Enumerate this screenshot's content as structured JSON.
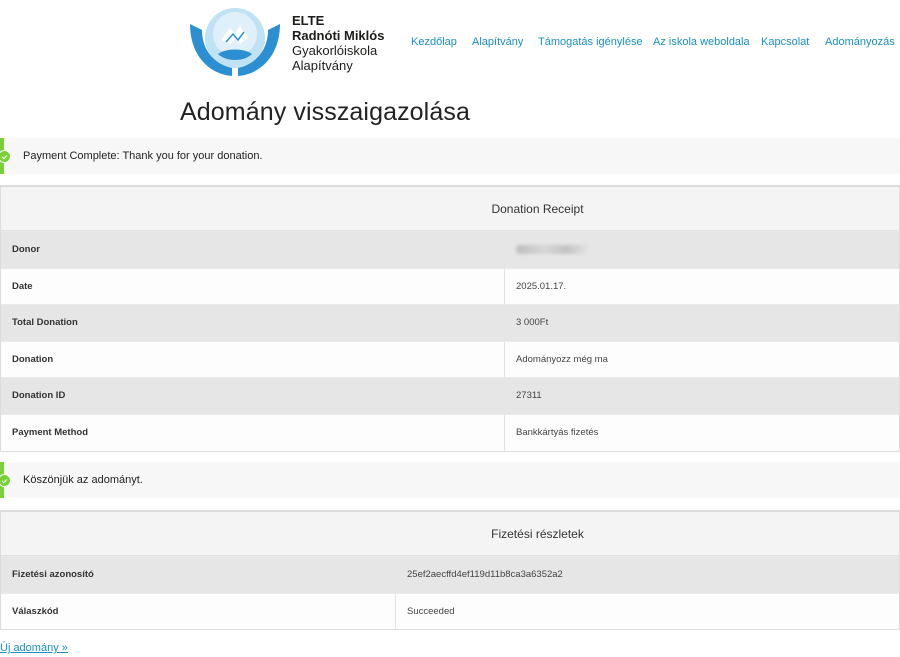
{
  "brand": {
    "line1": "ELTE",
    "line2": "Radnóti Miklós",
    "line3": "Gyakorlóiskola",
    "line4": "Alapítvány",
    "colors": {
      "logo_blue": "#2b8fd1",
      "logo_light": "#a5d4ef"
    }
  },
  "nav": {
    "items": [
      {
        "label": "Kezdőlap"
      },
      {
        "label": "Alapítvány"
      },
      {
        "label": "Támogatás igénylése"
      },
      {
        "label": "Az iskola weboldala"
      },
      {
        "label": "Kapcsolat"
      },
      {
        "label": "Adományozás"
      }
    ]
  },
  "page": {
    "title": "Adomány visszaigazolása"
  },
  "notices": {
    "payment": "Payment Complete: Thank you for your donation.",
    "thanks": "Köszönjük az adományt."
  },
  "receipt": {
    "title": "Donation Receipt",
    "rows": [
      {
        "label": "Donor",
        "value": ""
      },
      {
        "label": "Date",
        "value": "2025.01.17."
      },
      {
        "label": "Total Donation",
        "value": "3 000Ft"
      },
      {
        "label": "Donation",
        "value": "Adományozz még ma"
      },
      {
        "label": "Donation ID",
        "value": "27311"
      },
      {
        "label": "Payment Method",
        "value": "Bankkártyás fizetés"
      }
    ]
  },
  "payment_details": {
    "title": "Fizetési részletek",
    "rows": [
      {
        "label": "Fizetési azonosító",
        "value": "25ef2aecffd4ef119d11b8ca3a6352a2"
      },
      {
        "label": "Válaszkód",
        "value": "Succeeded"
      }
    ]
  },
  "footer": {
    "new_donation": "Új adomány »"
  },
  "colors": {
    "accent_link": "#1a8fc2",
    "success": "#7ad03a"
  }
}
